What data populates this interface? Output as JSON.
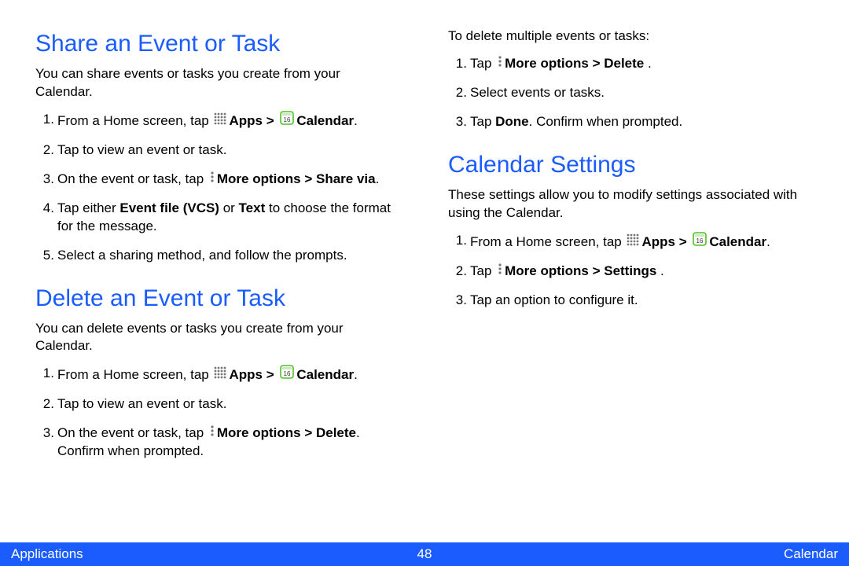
{
  "footer": {
    "left": "Applications",
    "page": "48",
    "right": "Calendar"
  },
  "left": {
    "share": {
      "heading": "Share an Event or Task",
      "intro": "You can share events or tasks you create from your Calendar.",
      "steps": {
        "s1_a": "From a Home screen, tap ",
        "s1_apps": "Apps > ",
        "s1_cal": "Calendar",
        "s1_end": ".",
        "s2": "Tap to view an event or task.",
        "s3_a": "On the event or task, tap ",
        "s3_more": "More options > Share via",
        "s3_end": ".",
        "s4_a": "Tap either ",
        "s4_b1": "Event file (VCS)",
        "s4_mid": " or ",
        "s4_b2": "Text",
        "s4_end": " to choose the format for the message.",
        "s5": "Select a sharing method, and follow the prompts."
      }
    },
    "delete": {
      "heading": "Delete an Event or Task",
      "intro": "You can delete events or tasks you create from your Calendar.",
      "steps": {
        "s1_a": "From a Home screen, tap ",
        "s1_apps": "Apps > ",
        "s1_cal": "Calendar",
        "s1_end": ".",
        "s2": "Tap to view an event or task.",
        "s3_a": "On the event or task, tap ",
        "s3_more": "More options > Delete",
        "s3_end": ". Confirm when prompted."
      }
    }
  },
  "right": {
    "multi": {
      "lead": "To delete multiple events or tasks:",
      "steps": {
        "s1_a": "Tap ",
        "s1_more": "More options > Delete ",
        "s1_end": ".",
        "s2": "Select events or tasks.",
        "s3_a": "Tap ",
        "s3_b": "Done",
        "s3_end": ". Confirm when prompted."
      }
    },
    "settings": {
      "heading": "Calendar Settings",
      "intro": "These settings allow you to modify settings associated with using the Calendar.",
      "steps": {
        "s1_a": "From a Home screen, tap ",
        "s1_apps": "Apps > ",
        "s1_cal": "Calendar",
        "s1_end": ".",
        "s2_a": "Tap ",
        "s2_more": "More options > Settings ",
        "s2_end": ".",
        "s3": "Tap an option to configure it."
      }
    }
  }
}
